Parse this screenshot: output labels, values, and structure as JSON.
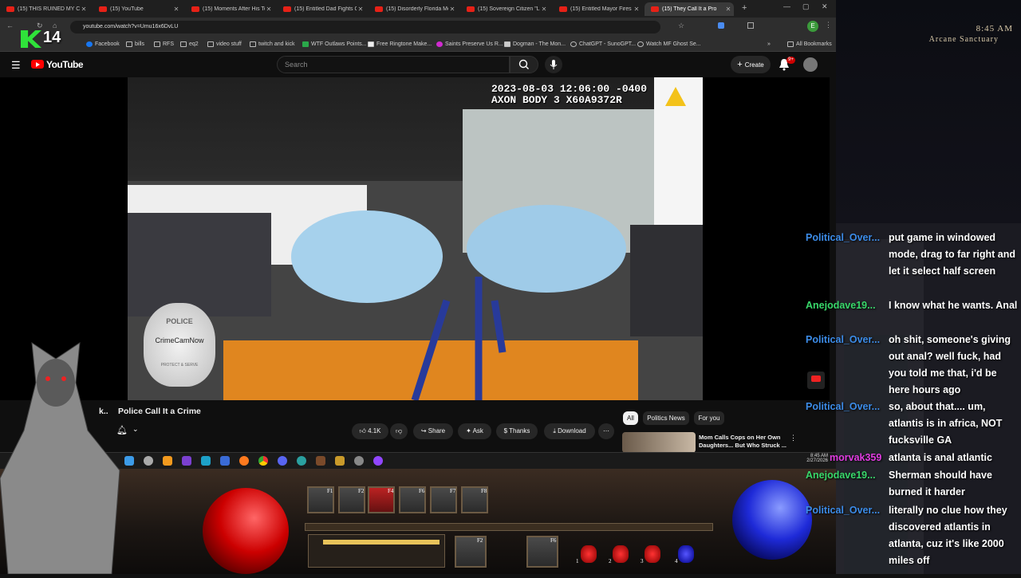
{
  "browser": {
    "tabs": [
      {
        "label": "(15) THIS RUINED MY CH"
      },
      {
        "label": "(15) YouTube"
      },
      {
        "label": "(15) Moments After His Te"
      },
      {
        "label": "(15) Entitled Dad Fights Co"
      },
      {
        "label": "(15) Disorderly Florida Me"
      },
      {
        "label": "(15) Sovereign Citizen \"La"
      },
      {
        "label": "(15) Entitled Mayor Fires &"
      },
      {
        "label": "(15) They Call It a Pro"
      }
    ],
    "url": "youtube.com/watch?v=Umu16x6DvLU",
    "bookmarks": [
      "Facebook",
      "bills",
      "RFS",
      "eq2",
      "video stuff",
      "twitch and kick",
      "WTF Outlaws Points...",
      "Free Ringtone Make...",
      "Saints Preserve Us R...",
      "Dogman - The Mon...",
      "ChatGPT - SunoGPT...",
      "Watch MF Ghost Se..."
    ],
    "all_bookmarks": "All Bookmarks",
    "profile_letter": "E"
  },
  "youtube": {
    "logo": "YouTube",
    "search_placeholder": "Search",
    "create_label": "Create",
    "notif_count": "9+",
    "video_overlay": {
      "timestamp": "2023-08-03 12:06:00 -0400",
      "camera": "AXON BODY 3 X60A9372R",
      "badge_top": "POLICE",
      "badge_name": "CrimeCamNow",
      "badge_bottom": "PROTECT & SERVE"
    },
    "title": "Police Call It a Crime",
    "title_prefix": "k..",
    "like_count": "4.1K",
    "actions": [
      "Share",
      "Ask",
      "Thanks",
      "Download"
    ],
    "chips": [
      "All",
      "Politics News",
      "For you"
    ],
    "recommended": {
      "title_line1": "Mom Calls Cops on Her Own",
      "title_line2": "Daughters... But Who Struck ..."
    }
  },
  "taskbar": {
    "clock_time": "8:45 AM",
    "clock_date": "2/27/2026"
  },
  "overlay": {
    "k_logo": "14",
    "clock": "8:45 AM",
    "location": "Arcane Sanctuary"
  },
  "game": {
    "skill_keys": [
      "F1",
      "F2",
      "F4",
      "F6",
      "F7",
      "F8"
    ],
    "belt_keys": [
      "F2",
      "F6"
    ],
    "potion_slots": [
      "1",
      "2",
      "3",
      "4"
    ]
  },
  "chat": [
    {
      "user": "Political_Over...",
      "color": "#3c8ce8",
      "message": "put game in windowed mode, drag to far right and let it select half screen"
    },
    {
      "user": "Anejodave19...",
      "color": "#38d86a",
      "message": "I know what he wants. Anal"
    },
    {
      "user": "Political_Over...",
      "color": "#3c8ce8",
      "message": "oh shit, someone's giving out anal? well fuck, had you told me that, i'd be here hours ago"
    },
    {
      "user": "Political_Over...",
      "color": "#3c8ce8",
      "message": "so, about that.... um, atlantis is in africa, NOT fucksville GA"
    },
    {
      "user": "morvak359",
      "color": "#e03ce0",
      "message": "atlanta is anal atlantic"
    },
    {
      "user": "Anejodave19...",
      "color": "#38d86a",
      "message": "Sherman should have burned it harder"
    },
    {
      "user": "Political_Over...",
      "color": "#3c8ce8",
      "message": "literally no clue how they discovered atlantis in atlanta, cuz it's like 2000 miles off"
    }
  ]
}
